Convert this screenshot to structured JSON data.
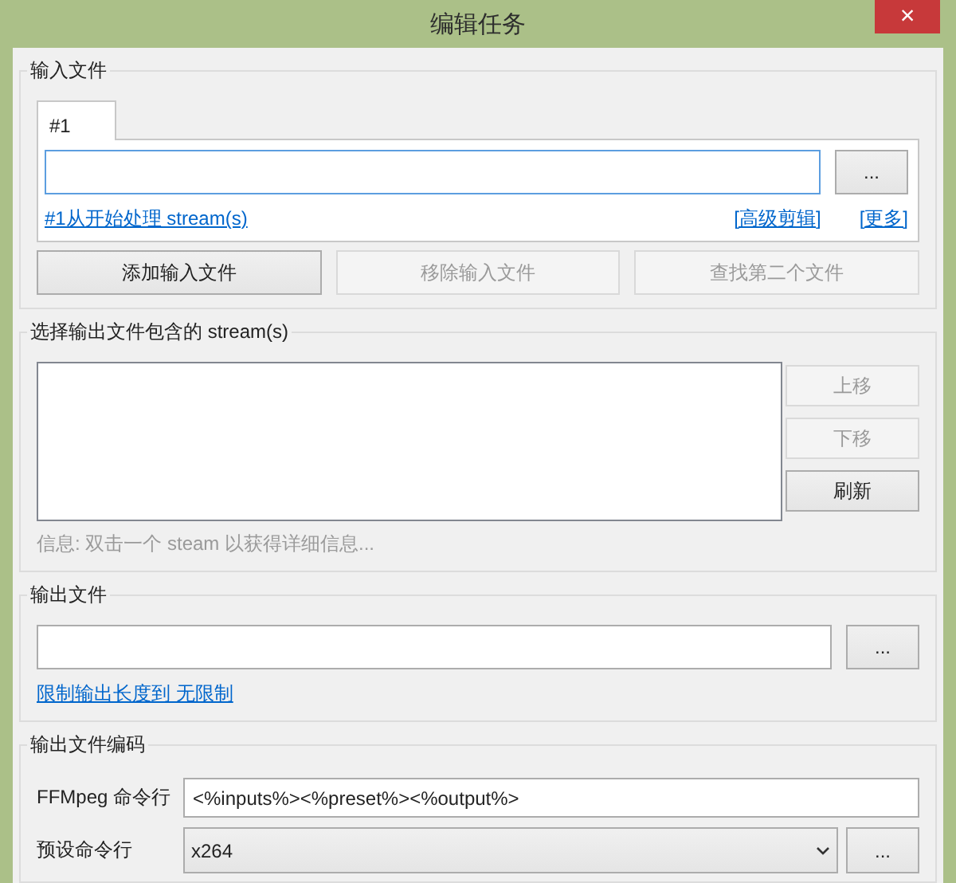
{
  "window": {
    "title": "编辑任务",
    "close": "×"
  },
  "input_files": {
    "label": "输入文件",
    "tabs": [
      {
        "label": "#1",
        "selected": true
      }
    ],
    "browse": "...",
    "links": [
      {
        "label": "#1从开始处理 stream(s)"
      },
      {
        "label": "[高级剪辑]"
      },
      {
        "label": "[更多]"
      }
    ],
    "buttons": [
      {
        "label": "添加输入文件",
        "disabled": false
      },
      {
        "label": "移除输入文件",
        "disabled": true
      },
      {
        "label": "查找第二个文件",
        "disabled": true
      }
    ]
  },
  "streams": {
    "label": "选择输出文件包含的 stream(s)",
    "buttons": [
      {
        "label": "上移",
        "disabled": true
      },
      {
        "label": "下移",
        "disabled": true
      },
      {
        "label": "刷新",
        "disabled": false
      }
    ],
    "info": "信息: 双击一个 steam 以获得详细信息..."
  },
  "output_file": {
    "label": "输出文件",
    "browse": "...",
    "link": "限制输出长度到 无限制"
  },
  "encoding": {
    "label": "输出文件编码",
    "rows": [
      {
        "kind": "text",
        "label": "FFMpeg 命令行",
        "value": "<%inputs%><%preset%><%output%>"
      },
      {
        "kind": "select",
        "label": "预设命令行",
        "value": "x264",
        "button": "..."
      }
    ]
  }
}
